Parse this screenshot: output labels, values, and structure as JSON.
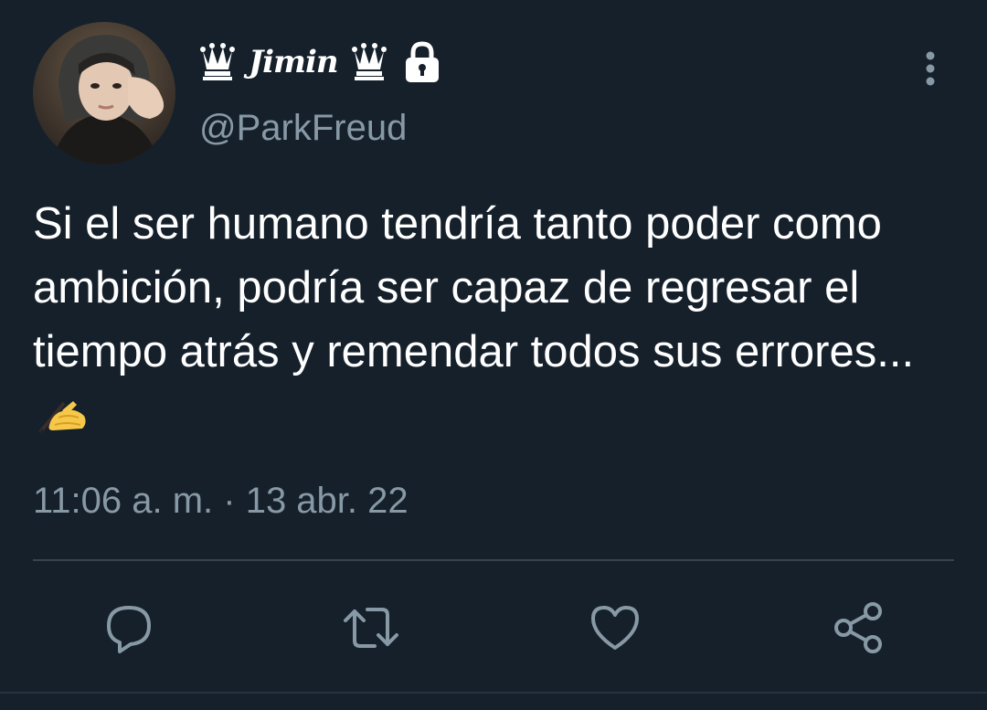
{
  "user": {
    "display_name": "Jimin",
    "crown_icon_left": "queen-chess-icon",
    "crown_icon_right": "queen-chess-icon",
    "protected_icon": "lock-icon",
    "handle": "@ParkFreud",
    "avatar": "profile-photo"
  },
  "tweet": {
    "text": "Si el ser humano tendría tanto poder como ambición, podría ser capaz de regresar el tiempo atrás y remendar todos sus errores...",
    "emoji": "writing-hand-emoji",
    "timestamp": "11:06 a. m. · 13 abr. 22"
  },
  "actions": {
    "reply": "reply-icon",
    "retweet": "retweet-icon",
    "like": "like-icon",
    "share": "share-icon"
  },
  "colors": {
    "background": "#15202b",
    "text": "#ffffff",
    "secondary_text": "#8899a6",
    "divider": "#38444d"
  }
}
